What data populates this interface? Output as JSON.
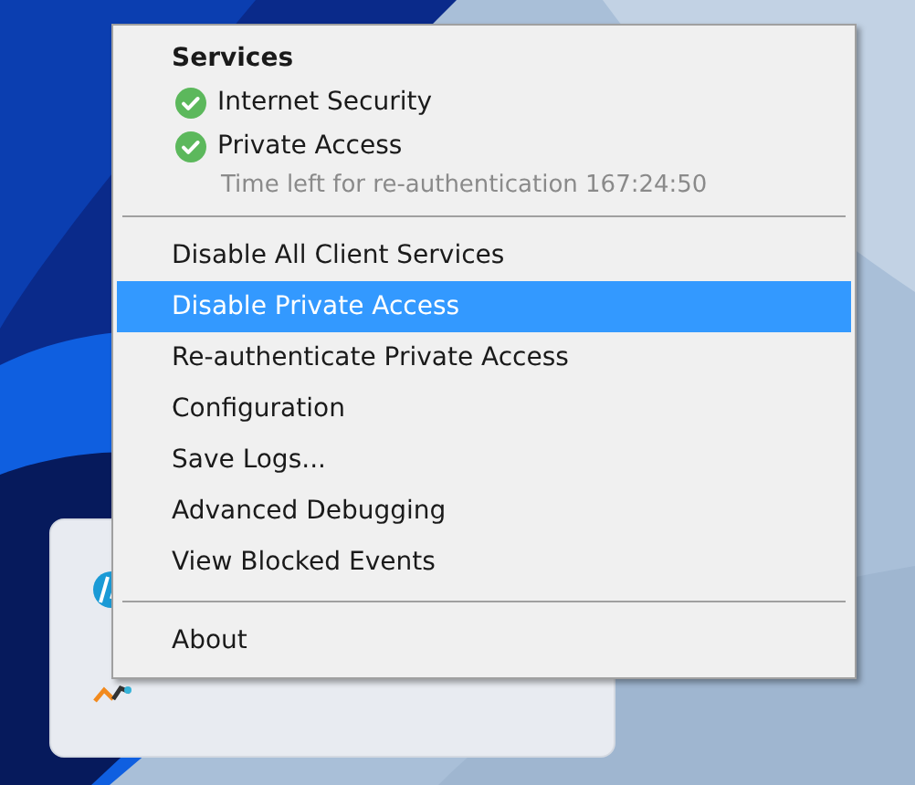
{
  "services": {
    "title": "Services",
    "items": [
      {
        "label": "Internet Security",
        "kind": "ok"
      },
      {
        "label": "Private Access",
        "kind": "ok"
      }
    ],
    "note": "Time left for re-authentication 167:24:50"
  },
  "menu_groups": [
    [
      {
        "label": "Disable All Client Services",
        "selected": false
      },
      {
        "label": "Disable Private Access",
        "selected": true
      },
      {
        "label": "Re-authenticate Private Access",
        "selected": false
      },
      {
        "label": "Configuration",
        "selected": false
      },
      {
        "label": "Save Logs...",
        "selected": false
      },
      {
        "label": "Advanced Debugging",
        "selected": false
      },
      {
        "label": "View Blocked Events",
        "selected": false
      }
    ],
    [
      {
        "label": "About",
        "selected": false
      }
    ]
  ]
}
